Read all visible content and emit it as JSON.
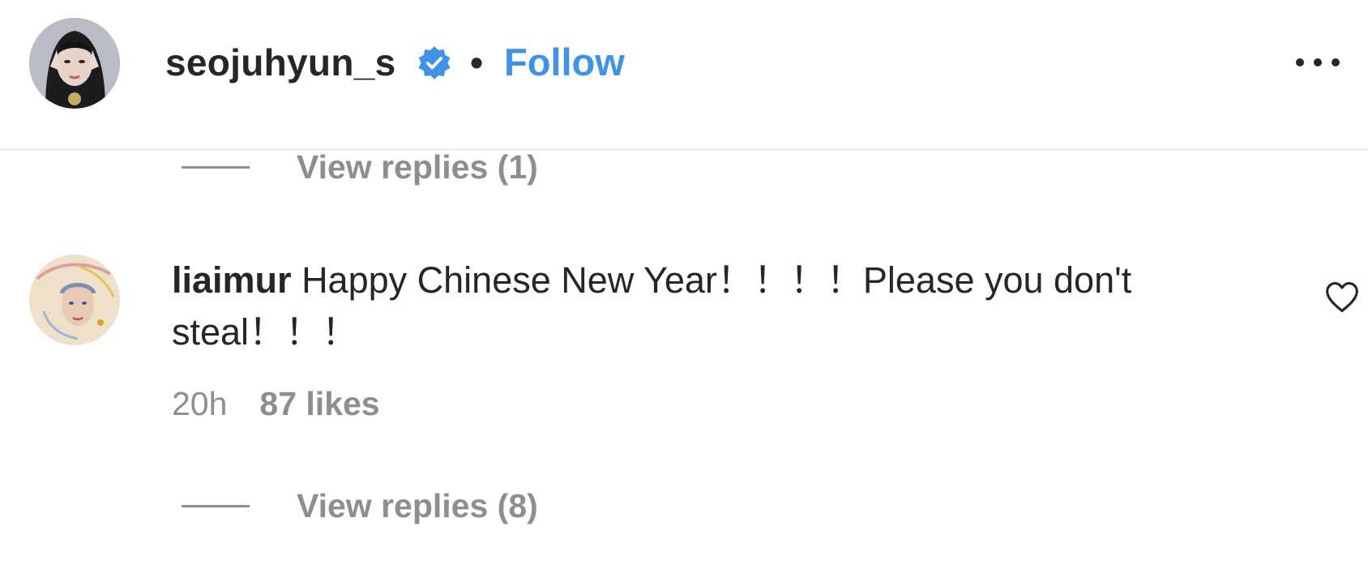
{
  "header": {
    "username": "seojuhyun_s",
    "separator": "•",
    "follow_label": "Follow",
    "verified_icon": "verified-badge-icon",
    "more_icon": "more-options-icon"
  },
  "thread": {
    "replies_top": "View replies (1)",
    "comment": {
      "username": "liaimur",
      "text": "Happy Chinese New Year！！！！Please you don't steal！！！",
      "time": "20h",
      "likes": "87 likes",
      "like_icon": "heart-outline-icon"
    },
    "replies_bottom": "View replies (8)"
  },
  "colors": {
    "follow": "#3f92e8",
    "verified": "#3f92e8",
    "muted": "#8e8e8e",
    "text": "#262626",
    "divider": "#efefef"
  }
}
